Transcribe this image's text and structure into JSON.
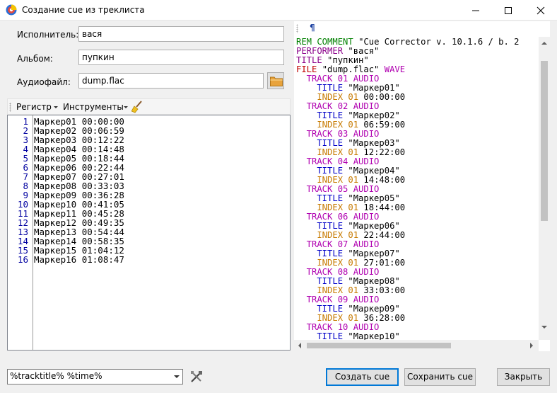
{
  "window": {
    "title": "Создание cue из треклиста"
  },
  "form": {
    "artist_label": "Исполнитель:",
    "artist_value": "вася",
    "album_label": "Альбом:",
    "album_value": "пупкин",
    "audiofile_label": "Аудиофайл:",
    "audiofile_value": "dump.flac"
  },
  "toolbar": {
    "register_label": "Регистр",
    "tools_label": "Инструменты"
  },
  "tracklist": [
    {
      "n": "1",
      "text": "Маркер01 00:00:00"
    },
    {
      "n": "2",
      "text": "Маркер02 00:06:59"
    },
    {
      "n": "3",
      "text": "Маркер03 00:12:22"
    },
    {
      "n": "4",
      "text": "Маркер04 00:14:48"
    },
    {
      "n": "5",
      "text": "Маркер05 00:18:44"
    },
    {
      "n": "6",
      "text": "Маркер06 00:22:44"
    },
    {
      "n": "7",
      "text": "Маркер07 00:27:01"
    },
    {
      "n": "8",
      "text": "Маркер08 00:33:03"
    },
    {
      "n": "9",
      "text": "Маркер09 00:36:28"
    },
    {
      "n": "10",
      "text": "Маркер10 00:41:05"
    },
    {
      "n": "11",
      "text": "Маркер11 00:45:28"
    },
    {
      "n": "12",
      "text": "Маркер12 00:49:35"
    },
    {
      "n": "13",
      "text": "Маркер13 00:54:44"
    },
    {
      "n": "14",
      "text": "Маркер14 00:58:35"
    },
    {
      "n": "15",
      "text": "Маркер15 01:04:12"
    },
    {
      "n": "16",
      "text": "Маркер16 01:08:47"
    }
  ],
  "cue_panel": {
    "pilcrow": "¶",
    "lines": [
      [
        {
          "t": "REM COMMENT ",
          "c": "kw-green"
        },
        {
          "t": "\"Cue Corrector v. 10.1.6 / b. 2",
          "c": ""
        }
      ],
      [
        {
          "t": "PERFORMER ",
          "c": "kw-purple"
        },
        {
          "t": "\"вася\"",
          "c": ""
        }
      ],
      [
        {
          "t": "TITLE ",
          "c": "kw-purple"
        },
        {
          "t": "\"пупкин\"",
          "c": ""
        }
      ],
      [
        {
          "t": "FILE ",
          "c": "kw-red"
        },
        {
          "t": "\"dump.flac\" ",
          "c": ""
        },
        {
          "t": "WAVE",
          "c": "kw-magenta"
        }
      ],
      [
        {
          "t": "  TRACK 01 AUDIO",
          "c": "kw-magenta"
        }
      ],
      [
        {
          "t": "    TITLE ",
          "c": "kw-blue"
        },
        {
          "t": "\"Маркер01\"",
          "c": ""
        }
      ],
      [
        {
          "t": "    INDEX 01 ",
          "c": "kw-orange"
        },
        {
          "t": "00:00:00",
          "c": ""
        }
      ],
      [
        {
          "t": "  TRACK 02 AUDIO",
          "c": "kw-magenta"
        }
      ],
      [
        {
          "t": "    TITLE ",
          "c": "kw-blue"
        },
        {
          "t": "\"Маркер02\"",
          "c": ""
        }
      ],
      [
        {
          "t": "    INDEX 01 ",
          "c": "kw-orange"
        },
        {
          "t": "06:59:00",
          "c": ""
        }
      ],
      [
        {
          "t": "  TRACK 03 AUDIO",
          "c": "kw-magenta"
        }
      ],
      [
        {
          "t": "    TITLE ",
          "c": "kw-blue"
        },
        {
          "t": "\"Маркер03\"",
          "c": ""
        }
      ],
      [
        {
          "t": "    INDEX 01 ",
          "c": "kw-orange"
        },
        {
          "t": "12:22:00",
          "c": ""
        }
      ],
      [
        {
          "t": "  TRACK 04 AUDIO",
          "c": "kw-magenta"
        }
      ],
      [
        {
          "t": "    TITLE ",
          "c": "kw-blue"
        },
        {
          "t": "\"Маркер04\"",
          "c": ""
        }
      ],
      [
        {
          "t": "    INDEX 01 ",
          "c": "kw-orange"
        },
        {
          "t": "14:48:00",
          "c": ""
        }
      ],
      [
        {
          "t": "  TRACK 05 AUDIO",
          "c": "kw-magenta"
        }
      ],
      [
        {
          "t": "    TITLE ",
          "c": "kw-blue"
        },
        {
          "t": "\"Маркер05\"",
          "c": ""
        }
      ],
      [
        {
          "t": "    INDEX 01 ",
          "c": "kw-orange"
        },
        {
          "t": "18:44:00",
          "c": ""
        }
      ],
      [
        {
          "t": "  TRACK 06 AUDIO",
          "c": "kw-magenta"
        }
      ],
      [
        {
          "t": "    TITLE ",
          "c": "kw-blue"
        },
        {
          "t": "\"Маркер06\"",
          "c": ""
        }
      ],
      [
        {
          "t": "    INDEX 01 ",
          "c": "kw-orange"
        },
        {
          "t": "22:44:00",
          "c": ""
        }
      ],
      [
        {
          "t": "  TRACK 07 AUDIO",
          "c": "kw-magenta"
        }
      ],
      [
        {
          "t": "    TITLE ",
          "c": "kw-blue"
        },
        {
          "t": "\"Маркер07\"",
          "c": ""
        }
      ],
      [
        {
          "t": "    INDEX 01 ",
          "c": "kw-orange"
        },
        {
          "t": "27:01:00",
          "c": ""
        }
      ],
      [
        {
          "t": "  TRACK 08 AUDIO",
          "c": "kw-magenta"
        }
      ],
      [
        {
          "t": "    TITLE ",
          "c": "kw-blue"
        },
        {
          "t": "\"Маркер08\"",
          "c": ""
        }
      ],
      [
        {
          "t": "    INDEX 01 ",
          "c": "kw-orange"
        },
        {
          "t": "33:03:00",
          "c": ""
        }
      ],
      [
        {
          "t": "  TRACK 09 AUDIO",
          "c": "kw-magenta"
        }
      ],
      [
        {
          "t": "    TITLE ",
          "c": "kw-blue"
        },
        {
          "t": "\"Маркер09\"",
          "c": ""
        }
      ],
      [
        {
          "t": "    INDEX 01 ",
          "c": "kw-orange"
        },
        {
          "t": "36:28:00",
          "c": ""
        }
      ],
      [
        {
          "t": "  TRACK 10 AUDIO",
          "c": "kw-magenta"
        }
      ],
      [
        {
          "t": "    TITLE ",
          "c": "kw-blue"
        },
        {
          "t": "\"Маркер10\"",
          "c": ""
        }
      ]
    ]
  },
  "bottom": {
    "template_value": "%tracktitle% %time%",
    "create_label": "Создать cue",
    "save_label": "Сохранить cue",
    "close_label": "Закрыть"
  },
  "colors": {
    "accent": "#0078d7",
    "keyword_green": "#008000",
    "keyword_purple": "#8b008b",
    "keyword_orange": "#c77a00",
    "line_number": "#0000a0"
  },
  "icons": [
    "app-icon",
    "minimize-icon",
    "maximize-icon",
    "close-icon",
    "folder-icon",
    "broom-icon",
    "tools-icon",
    "chevron-down-icon",
    "pilcrow-icon"
  ]
}
